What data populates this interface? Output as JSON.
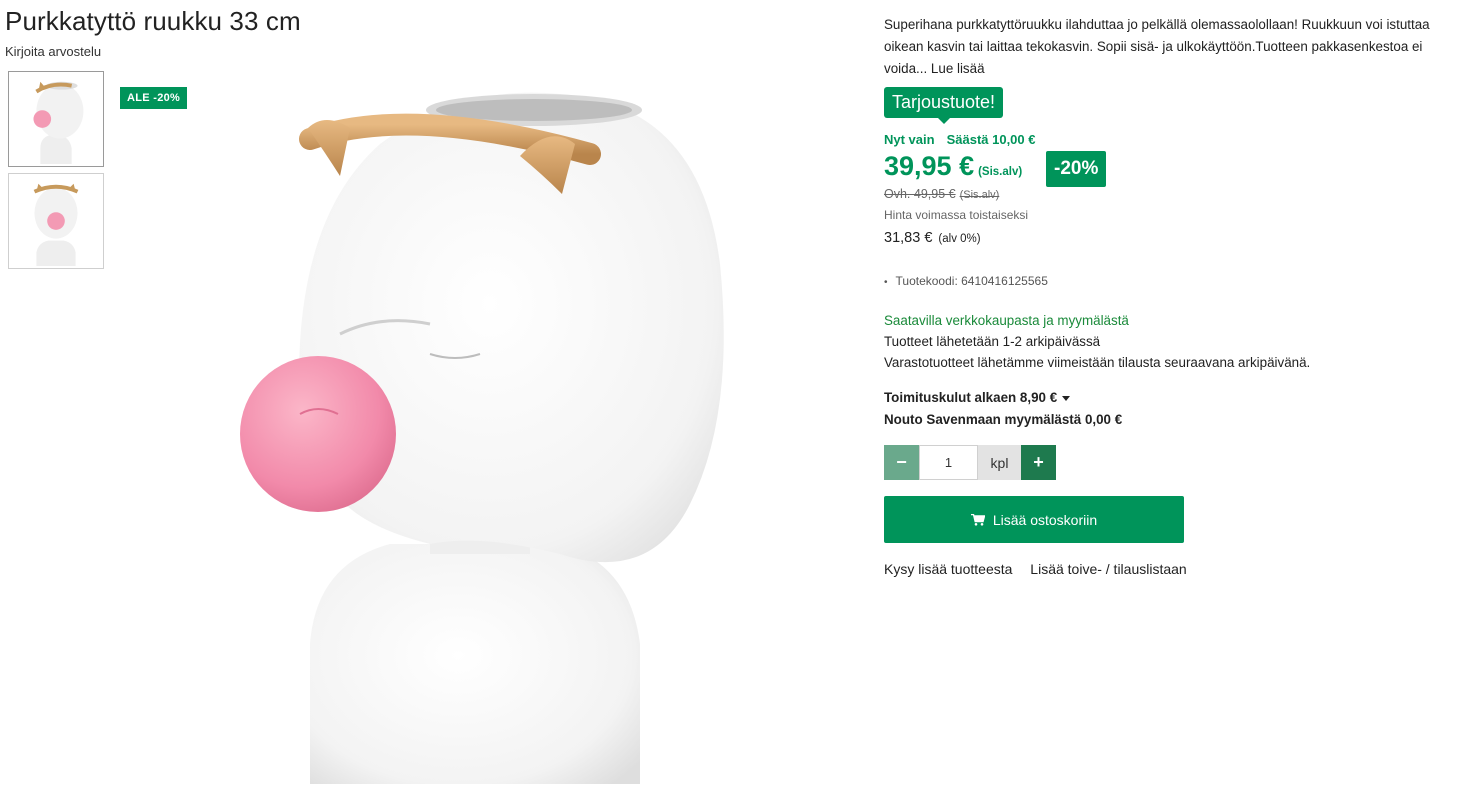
{
  "product": {
    "title": "Purkkatyttö ruukku 33 cm",
    "review_link": "Kirjoita arvostelu",
    "sale_badge": "ALE -20%",
    "description": "Superihana purkkatyttöruukku ilahduttaa jo pelkällä olemassaolollaan! Ruukkuun voi istuttaa oikean kasvin tai laittaa tekokasvin. Sopii sisä- ja ulkokäyttöön.Tuotteen pakkasenkestoa ei voida...",
    "read_more": "Lue lisää",
    "code": "Tuotekoodi: 6410416125565"
  },
  "pricing": {
    "offer_label": "Tarjoustuote!",
    "now_label": "Nyt vain",
    "save_label": "Säästä 10,00 €",
    "price": "39,95 €",
    "price_vat": "(Sis.alv)",
    "discount_badge": "-20%",
    "old_price": "Ovh. 49,95 €",
    "old_price_vat": "(Sis.alv)",
    "validity": "Hinta voimassa toistaiseksi",
    "net_price": "31,83 €",
    "net_vat": "(alv 0%)"
  },
  "availability": {
    "status": "Saatavilla verkkokaupasta ja myymälästä",
    "line1": "Tuotteet lähetetään 1-2 arkipäivässä",
    "line2": "Varastotuotteet lähetämme viimeistään tilausta seuraavana arkipäivänä."
  },
  "shipping": {
    "delivery": "Toimituskulut alkaen 8,90 €",
    "pickup": "Nouto Savenmaan myymälästä 0,00 €"
  },
  "quantity": {
    "minus": "−",
    "value": "1",
    "unit": "kpl",
    "plus": "+"
  },
  "actions": {
    "add_to_cart": "Lisää ostoskoriin",
    "ask_more": "Kysy lisää tuotteesta",
    "wishlist": "Lisää toive- / tilauslistaan"
  },
  "colors": {
    "brand_green": "#00945a"
  }
}
